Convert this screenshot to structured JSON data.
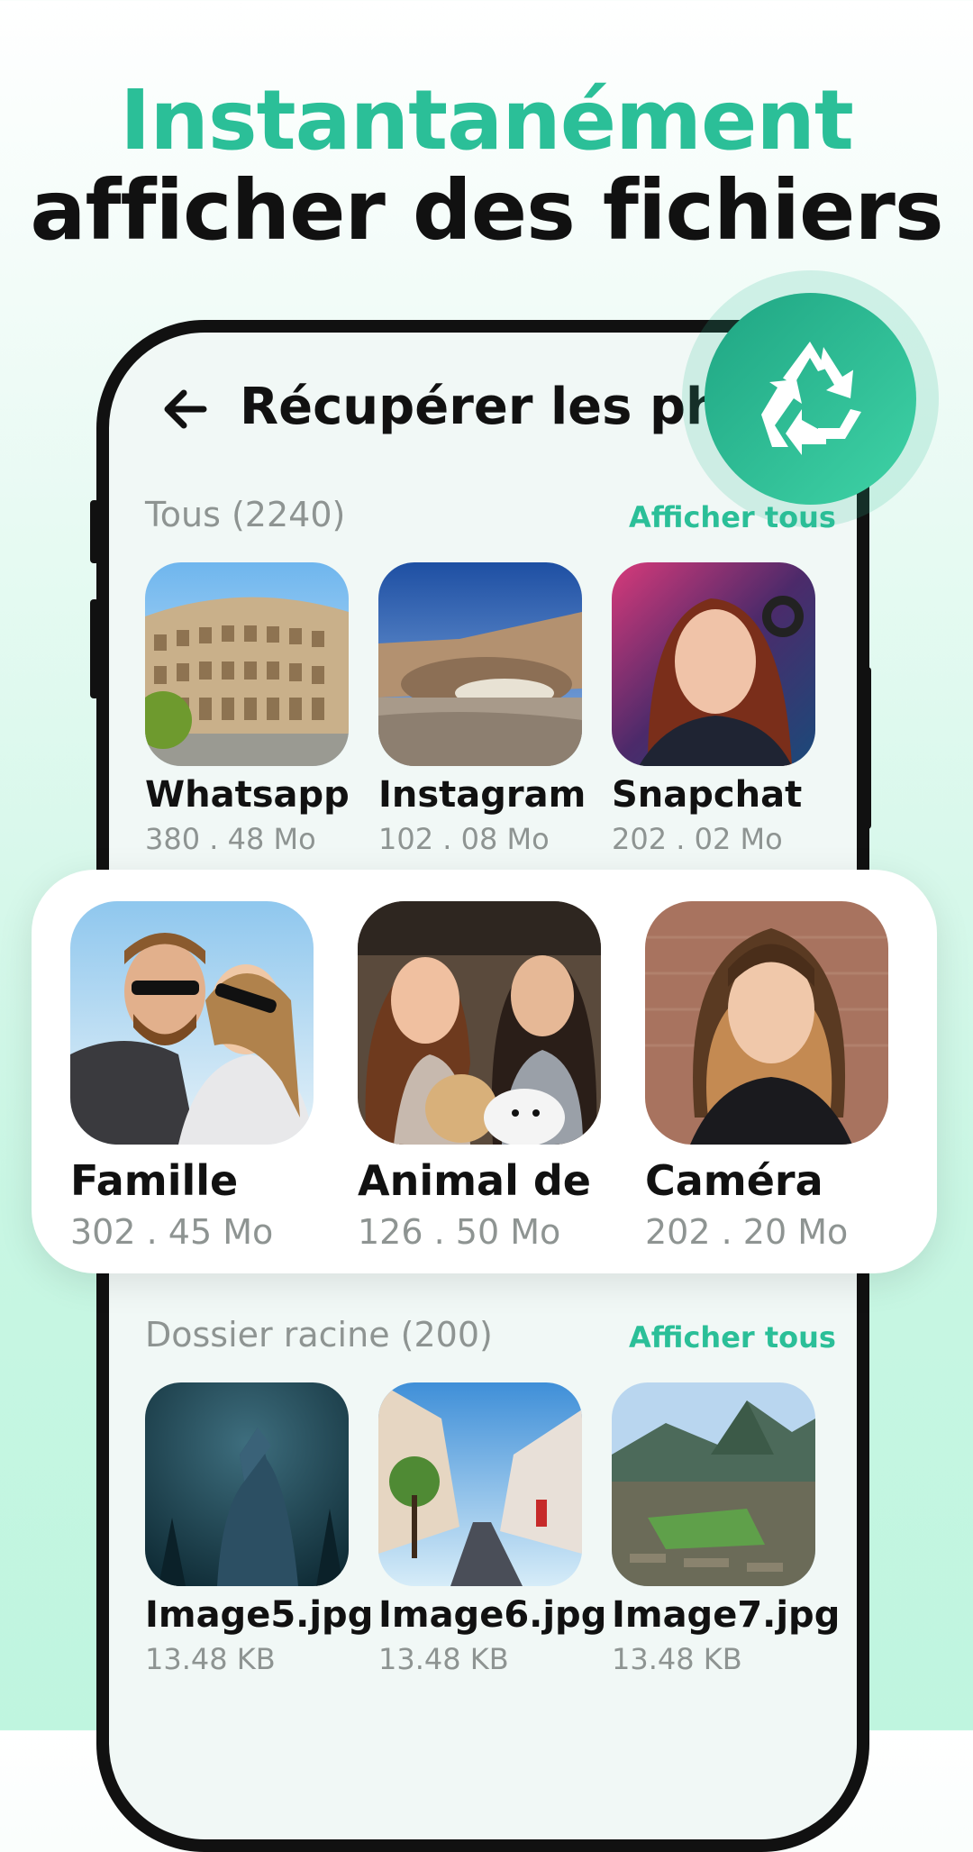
{
  "headline": {
    "line1": "Instantanément",
    "line2": "afficher des fichiers"
  },
  "screen": {
    "title": "Récupérer les pho",
    "back_icon": "arrow-left-icon",
    "badge_icon": "recycle-icon",
    "section_all": {
      "title": "Tous (2240)",
      "link": "Afficher tous",
      "items": [
        {
          "name": "Whatsapp",
          "size": "380 . 48 Mo"
        },
        {
          "name": "Instagram",
          "size": "102 . 08 Mo"
        },
        {
          "name": "Snapchat",
          "size": "202 . 02 Mo"
        }
      ]
    },
    "highlight": {
      "items": [
        {
          "name": "Famille",
          "size": "302 . 45 Mo"
        },
        {
          "name": "Animal de",
          "size": "126 . 50 Mo"
        },
        {
          "name": "Caméra",
          "size": "202 . 20 Mo"
        }
      ]
    },
    "section_root": {
      "title": "Dossier racine (200)",
      "link": "Afficher tous",
      "items": [
        {
          "name": "Image5.jpg",
          "size": "13.48 KB"
        },
        {
          "name": "Image6.jpg",
          "size": "13.48 KB"
        },
        {
          "name": "Image7.jpg",
          "size": "13.48 KB"
        }
      ]
    }
  },
  "colors": {
    "accent": "#2bbf98",
    "text": "#111111",
    "muted": "#8e9492"
  }
}
